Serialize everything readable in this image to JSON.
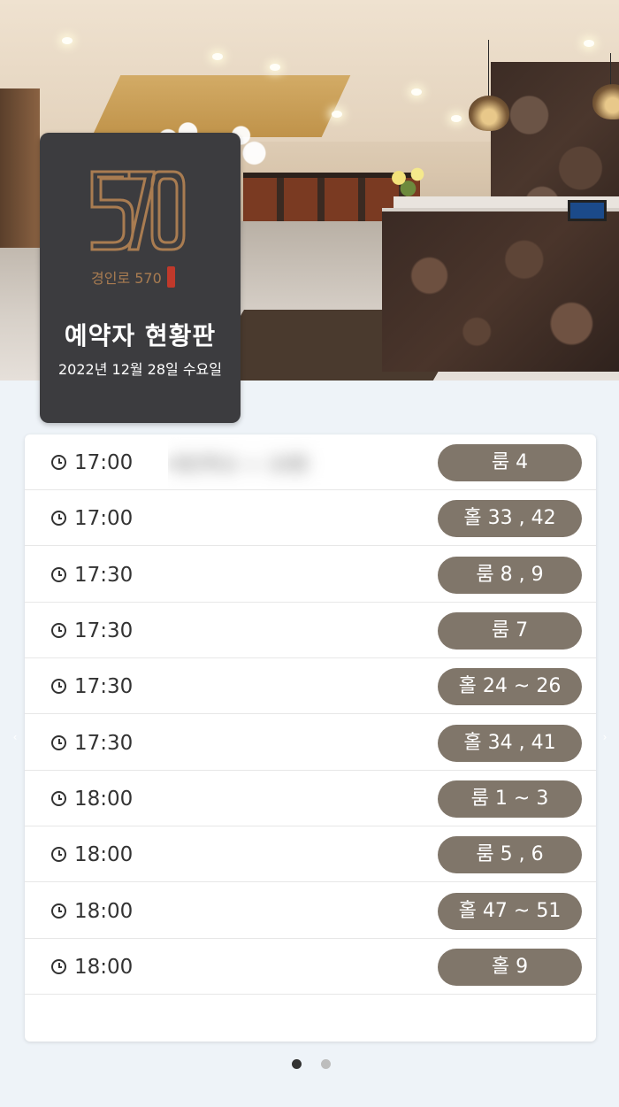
{
  "hero": {
    "photo_icon": "restaurant-interior-photo"
  },
  "board": {
    "logo_icon": "570-logo-mark",
    "logo_caption": "경인로 570",
    "logo_seal": "",
    "title": "예약자 현황판",
    "date": "2022년 12월 28일 수요일"
  },
  "reservations": [
    {
      "time": "17:00",
      "booker": "세인학교 ㅅ 10명",
      "room": "룸 4"
    },
    {
      "time": "17:00",
      "booker": "",
      "room": "홀 33 , 42"
    },
    {
      "time": "17:30",
      "booker": "",
      "room": "룸 8 , 9"
    },
    {
      "time": "17:30",
      "booker": "",
      "room": "룸 7"
    },
    {
      "time": "17:30",
      "booker": "",
      "room": "홀 24 ~ 26"
    },
    {
      "time": "17:30",
      "booker": "",
      "room": "홀 34 , 41"
    },
    {
      "time": "18:00",
      "booker": "",
      "room": "룸 1 ~ 3"
    },
    {
      "time": "18:00",
      "booker": "",
      "room": "룸 5 , 6"
    },
    {
      "time": "18:00",
      "booker": "",
      "room": "홀 47 ~ 51"
    },
    {
      "time": "18:00",
      "booker": "",
      "room": "홀 9"
    }
  ],
  "icons": {
    "clock": "clock-icon",
    "prev": "chevron-left-icon",
    "next": "chevron-right-icon"
  },
  "carousel": {
    "pages": 2,
    "active_page": 1
  },
  "colors": {
    "page_bg": "#eef3f8",
    "board_bg": "#3c3c3f",
    "logo_brown": "#a97c51",
    "pill_bg": "#80766a"
  }
}
